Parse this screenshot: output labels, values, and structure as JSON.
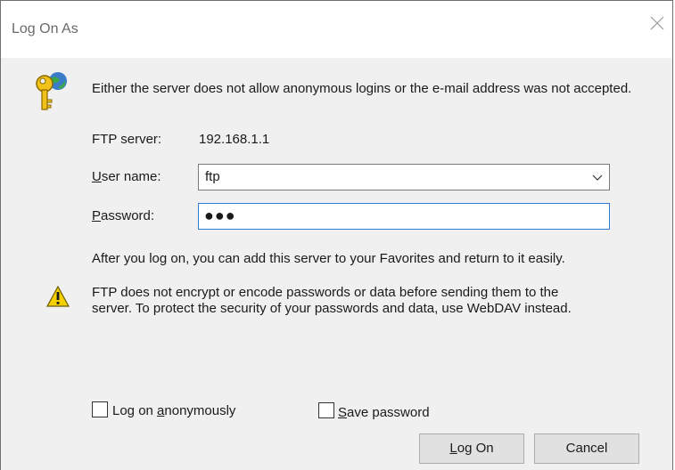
{
  "window": {
    "title": "Log On As",
    "close_glyph": "✕"
  },
  "message": "Either the server does not allow anonymous logins or the e-mail address was not accepted.",
  "ftp_server": {
    "label": "FTP server:",
    "value": "192.168.1.1"
  },
  "user_name": {
    "label_accel": "U",
    "label_rest": "ser name:",
    "value": "ftp"
  },
  "password": {
    "label_accel": "P",
    "label_rest": "assword:",
    "masked_value": "●●●"
  },
  "info_text": "After you log on, you can add this server to your Favorites and return to it easily.",
  "warning": {
    "line1": "FTP does not encrypt or encode passwords or data before sending them to the",
    "line2": "server.  To protect the security of your passwords and data, use WebDAV instead."
  },
  "anonymous_checkbox": {
    "label_pre": "Log on ",
    "label_accel": "a",
    "label_post": "nonymously",
    "checked": false
  },
  "save_password_checkbox": {
    "label_accel": "S",
    "label_rest": "ave password",
    "checked": false
  },
  "buttons": {
    "logon_accel": "L",
    "logon_rest": "og On",
    "cancel": "Cancel"
  },
  "icons": {
    "key": "key-globe-icon",
    "warning": "warning-icon",
    "close": "close-icon",
    "dropdown": "chevron-down-icon"
  },
  "colors": {
    "dialog_bg": "#f0f0f0",
    "focus_border": "#2b7bd3",
    "warning_yellow": "#f5d000"
  }
}
